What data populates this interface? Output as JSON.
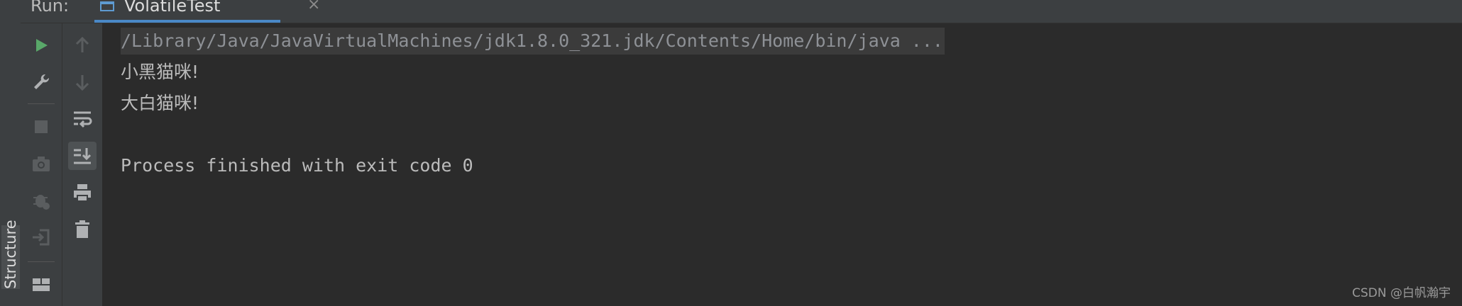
{
  "run_panel": {
    "label": "Run:",
    "tab_title": "VolatileTest",
    "tab_close": "×"
  },
  "side": {
    "structure_label": "Structure"
  },
  "toolbar": {
    "primary": [
      "run-icon",
      "wrench-icon",
      "stop-icon",
      "camera-icon",
      "debug-icon",
      "login-icon",
      "layout-icon"
    ],
    "secondary": [
      "arrow-up-icon",
      "arrow-down-icon",
      "soft-wrap-icon",
      "scroll-to-end-icon",
      "print-icon",
      "trash-icon"
    ]
  },
  "console": {
    "lines": [
      "/Library/Java/JavaVirtualMachines/jdk1.8.0_321.jdk/Contents/Home/bin/java ...",
      "小黑猫咪!",
      "大白猫咪!",
      "",
      "Process finished with exit code 0"
    ]
  },
  "watermark": "CSDN @白帆瀚宇",
  "colors": {
    "background": "#2b2b2b",
    "panel": "#3c3f41",
    "run_green": "#59a869",
    "accent": "#4a88c7",
    "text": "#bbbbbb"
  }
}
